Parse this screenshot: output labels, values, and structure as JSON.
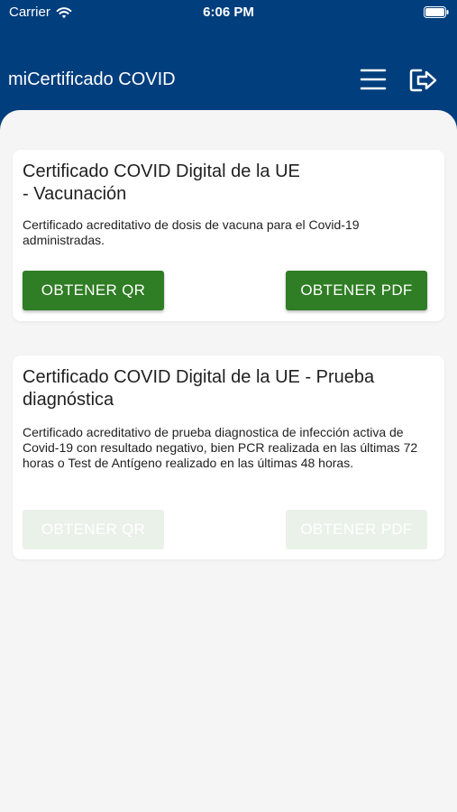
{
  "status_bar": {
    "carrier": "Carrier",
    "time": "6:06 PM"
  },
  "app_bar": {
    "title": "miCertificado COVID",
    "background": "#003e7d"
  },
  "cards": [
    {
      "title": "Certificado COVID Digital de la UE\n- Vacunación",
      "description": "Certificado acreditativo de dosis de vacuna para el Covid-19 administradas.",
      "qr_label": "OBTENER QR",
      "pdf_label": "OBTENER PDF",
      "enabled": true
    },
    {
      "title": "Certificado COVID Digital de la UE - Prueba diagnóstica",
      "description": "Certificado acreditativo de prueba diagnostica de infección activa de Covid-19 con resultado negativo, bien PCR realizada en las últimas 72 horas o Test de Antígeno realizado en las últimas 48 horas.",
      "qr_label": "OBTENER QR",
      "pdf_label": "OBTENER PDF",
      "enabled": false
    }
  ],
  "colors": {
    "button_active": "#2f7d24",
    "button_disabled": "#eaf1e9",
    "content_background": "#f5f5f5"
  }
}
